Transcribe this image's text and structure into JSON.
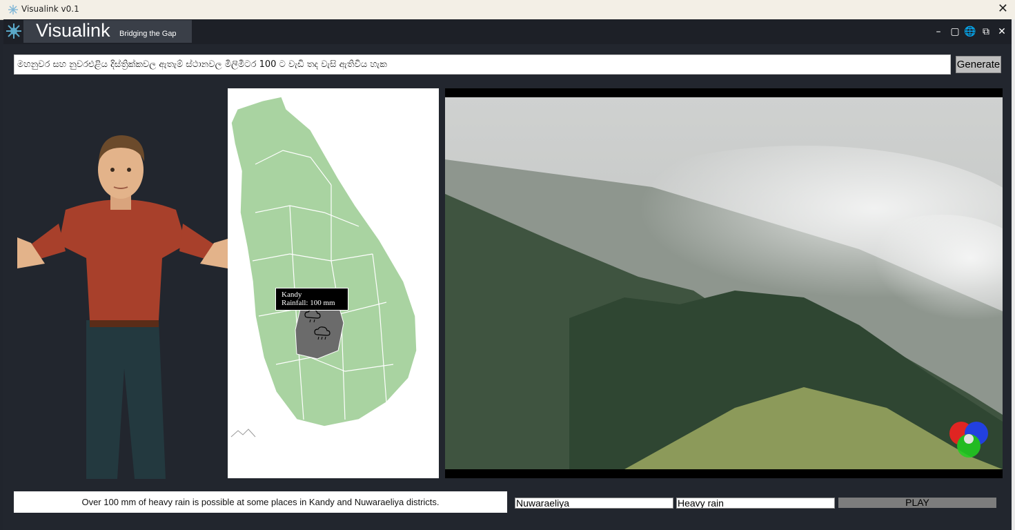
{
  "window": {
    "title": "Visualink v0.1",
    "close_glyph": "✕"
  },
  "header": {
    "brand_name": "Visualink",
    "tagline": "Bridging the Gap",
    "controls": [
      {
        "name": "minimize-icon",
        "glyph": "–"
      },
      {
        "name": "maximize-icon",
        "glyph": "▢"
      },
      {
        "name": "globe-icon",
        "glyph": "🌐"
      },
      {
        "name": "restore-icon",
        "glyph": "⧉"
      },
      {
        "name": "close-icon",
        "glyph": "✕"
      }
    ]
  },
  "input": {
    "value": "මහනුවර සහ නුවරඑළිය දිස්ත්‍රික්කවල ඇතැම් ස්ථානවල මිලිමීටර 100 ට වැඩි තද වැසි ඇතිවිය හැක",
    "generate_label": "Generate"
  },
  "map": {
    "tooltip_line1": "Kandy",
    "tooltip_line2": "Rainfall: 100 mm",
    "highlight_color": "#6b6b6b",
    "land_color": "#a9d3a1"
  },
  "caption": "Over 100 mm of heavy rain is possible at some places in Kandy and Nuwaraeliya districts.",
  "fields": {
    "location": "Nuwaraeliya",
    "condition": "Heavy rain"
  },
  "play_label": "PLAY",
  "icons": {
    "app": "snowflake-icon",
    "logo": "snowflake-icon",
    "rain": "rain-cloud-icon",
    "rgb": "rgb-circles-icon"
  }
}
